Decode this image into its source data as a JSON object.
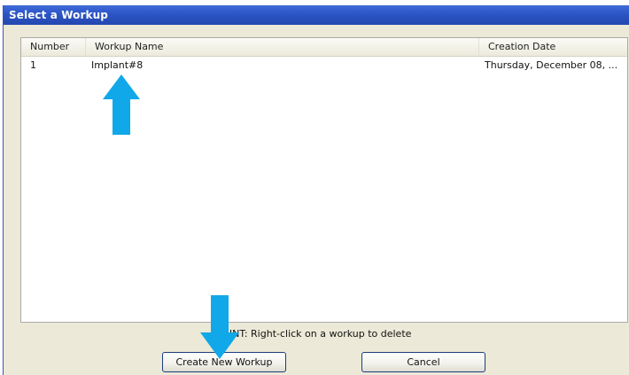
{
  "window": {
    "title": "Select a Workup"
  },
  "list": {
    "columns": [
      "Number",
      "Workup Name",
      "Creation Date"
    ],
    "rows": [
      {
        "number": "1",
        "name": "Implant#8",
        "date": "Thursday, December 08, ..."
      }
    ]
  },
  "hint": "HINT: Right-click on a workup to delete",
  "buttons": {
    "create": "Create New Workup",
    "cancel": "Cancel"
  },
  "colors": {
    "titlebar": "#2c54c4",
    "arrow": "#10a8e8",
    "dialog_bg": "#ece9d8"
  }
}
